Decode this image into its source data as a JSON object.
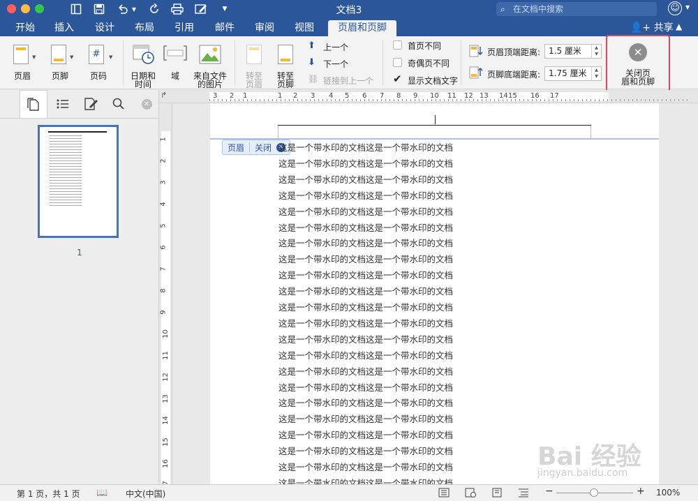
{
  "window": {
    "title": "文档3",
    "search_placeholder": "在文档中搜索"
  },
  "tabs": [
    {
      "label": "开始"
    },
    {
      "label": "插入"
    },
    {
      "label": "设计"
    },
    {
      "label": "布局"
    },
    {
      "label": "引用"
    },
    {
      "label": "邮件"
    },
    {
      "label": "审阅"
    },
    {
      "label": "视图"
    },
    {
      "label": "页眉和页脚"
    }
  ],
  "active_tab": "页眉和页脚",
  "share_label": "共享",
  "ribbon": {
    "header_label": "页眉",
    "footer_label": "页脚",
    "page_number_label": "页码",
    "datetime_label_1": "日期和",
    "datetime_label_2": "时间",
    "field_label": "域",
    "picture_label_1": "来自文件",
    "picture_label_2": "的图片",
    "goto_header_label_1": "转至",
    "goto_header_label_2": "页眉",
    "goto_footer_label_1": "转至",
    "goto_footer_label_2": "页脚",
    "previous_label": "上一个",
    "next_label": "下一个",
    "link_previous_label": "链接到上一个",
    "different_first_label": "首页不同",
    "different_odd_even_label": "奇偶页不同",
    "show_document_text_label": "显示文档文字",
    "header_top_label": "页眉顶端距离:",
    "header_top_value": "1.5 厘米",
    "footer_bottom_label": "页脚底端距离:",
    "footer_bottom_value": "1.75 厘米",
    "close_label_1": "关闭页",
    "close_label_2": "眉和页脚"
  },
  "checkboxes": {
    "different_first": false,
    "different_odd_even": false,
    "show_document_text": true
  },
  "sidebar": {
    "page_number": "1"
  },
  "ruler": {
    "h_labels": [
      "3",
      "2",
      "1",
      "1",
      "2",
      "3",
      "4",
      "5",
      "6",
      "7",
      "8",
      "9",
      "10",
      "11",
      "12",
      "13",
      "14",
      "15",
      "16",
      "17"
    ],
    "v_labels": [
      "1",
      "2",
      "3",
      "4",
      "5",
      "6",
      "7",
      "8",
      "9",
      "10",
      "11",
      "12",
      "13",
      "14",
      "15",
      "16",
      "17"
    ]
  },
  "document": {
    "header_tag": "页眉",
    "close_tag": "关闭",
    "body_line": "这是一个带水印的文档这是一个带水印的文档",
    "line_count": 22
  },
  "statusbar": {
    "page_info": "第 1 页，共 1 页",
    "language": "中文(中国)",
    "zoom": "100%"
  },
  "watermark": {
    "logo_text": "Bai 经验",
    "url": "jingyan.baidu.com"
  },
  "colors": {
    "brand": "#2b579a",
    "highlight_box": "#e0475b"
  }
}
